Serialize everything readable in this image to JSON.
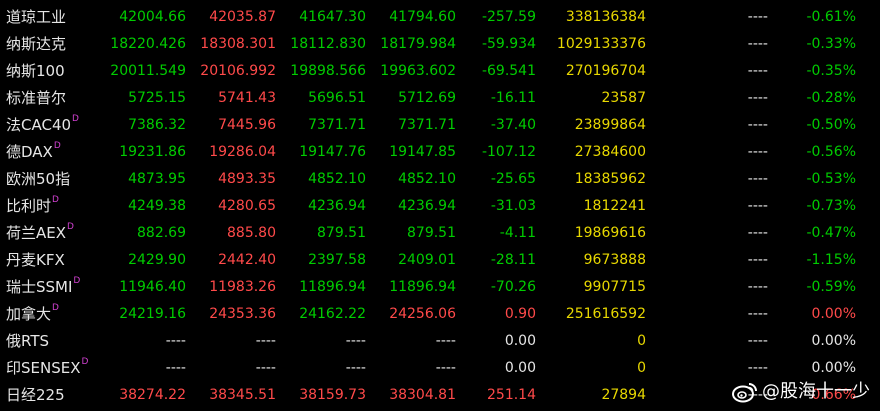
{
  "rows": [
    {
      "name": "道琼工业",
      "d": "",
      "v": [
        "42004.66",
        "42035.87",
        "41647.30",
        "41794.60",
        "-257.59",
        "338136384",
        "----",
        "-0.61%"
      ],
      "c": [
        "g",
        "r",
        "g",
        "g",
        "g",
        "y",
        "w",
        "g"
      ]
    },
    {
      "name": "纳斯达克",
      "d": "",
      "v": [
        "18220.426",
        "18308.301",
        "18112.830",
        "18179.984",
        "-59.934",
        "1029133376",
        "----",
        "-0.33%"
      ],
      "c": [
        "g",
        "r",
        "g",
        "g",
        "g",
        "y",
        "w",
        "g"
      ]
    },
    {
      "name": "纳斯100",
      "d": "",
      "v": [
        "20011.549",
        "20106.992",
        "19898.566",
        "19963.602",
        "-69.541",
        "270196704",
        "----",
        "-0.35%"
      ],
      "c": [
        "g",
        "r",
        "g",
        "g",
        "g",
        "y",
        "w",
        "g"
      ]
    },
    {
      "name": "标准普尔",
      "d": "",
      "v": [
        "5725.15",
        "5741.43",
        "5696.51",
        "5712.69",
        "-16.11",
        "23587",
        "----",
        "-0.28%"
      ],
      "c": [
        "g",
        "r",
        "g",
        "g",
        "g",
        "y",
        "w",
        "g"
      ]
    },
    {
      "name": "法CAC40",
      "d": "D",
      "v": [
        "7386.32",
        "7445.96",
        "7371.71",
        "7371.71",
        "-37.40",
        "23899864",
        "----",
        "-0.50%"
      ],
      "c": [
        "g",
        "r",
        "g",
        "g",
        "g",
        "y",
        "w",
        "g"
      ]
    },
    {
      "name": "德DAX",
      "d": "D",
      "v": [
        "19231.86",
        "19286.04",
        "19147.76",
        "19147.85",
        "-107.12",
        "27384600",
        "----",
        "-0.56%"
      ],
      "c": [
        "g",
        "r",
        "g",
        "g",
        "g",
        "y",
        "w",
        "g"
      ]
    },
    {
      "name": "欧洲50指",
      "d": "",
      "v": [
        "4873.95",
        "4893.35",
        "4852.10",
        "4852.10",
        "-25.65",
        "18385962",
        "----",
        "-0.53%"
      ],
      "c": [
        "g",
        "r",
        "g",
        "g",
        "g",
        "y",
        "w",
        "g"
      ]
    },
    {
      "name": "比利时",
      "d": "D",
      "v": [
        "4249.38",
        "4280.65",
        "4236.94",
        "4236.94",
        "-31.03",
        "1812241",
        "----",
        "-0.73%"
      ],
      "c": [
        "g",
        "r",
        "g",
        "g",
        "g",
        "y",
        "w",
        "g"
      ]
    },
    {
      "name": "荷兰AEX",
      "d": "D",
      "v": [
        "882.69",
        "885.80",
        "879.51",
        "879.51",
        "-4.11",
        "19869616",
        "----",
        "-0.47%"
      ],
      "c": [
        "g",
        "r",
        "g",
        "g",
        "g",
        "y",
        "w",
        "g"
      ]
    },
    {
      "name": "丹麦KFX",
      "d": "",
      "v": [
        "2429.90",
        "2442.40",
        "2397.58",
        "2409.01",
        "-28.11",
        "9673888",
        "----",
        "-1.15%"
      ],
      "c": [
        "g",
        "r",
        "g",
        "g",
        "g",
        "y",
        "w",
        "g"
      ]
    },
    {
      "name": "瑞士SSMI",
      "d": "D",
      "v": [
        "11946.40",
        "11983.26",
        "11896.94",
        "11896.94",
        "-70.26",
        "9907715",
        "----",
        "-0.59%"
      ],
      "c": [
        "g",
        "r",
        "g",
        "g",
        "g",
        "y",
        "w",
        "g"
      ]
    },
    {
      "name": "加拿大",
      "d": "D",
      "v": [
        "24219.16",
        "24353.36",
        "24162.22",
        "24256.06",
        "0.90",
        "251616592",
        "----",
        "0.00%"
      ],
      "c": [
        "g",
        "r",
        "g",
        "r",
        "r",
        "y",
        "w",
        "r"
      ]
    },
    {
      "name": "俄RTS",
      "d": "",
      "v": [
        "----",
        "----",
        "----",
        "----",
        "0.00",
        "0",
        "----",
        "0.00%"
      ],
      "c": [
        "w",
        "w",
        "w",
        "w",
        "w",
        "y",
        "w",
        "w"
      ]
    },
    {
      "name": "印SENSEX",
      "d": "D",
      "v": [
        "----",
        "----",
        "----",
        "----",
        "0.00",
        "0",
        "----",
        "0.00%"
      ],
      "c": [
        "w",
        "w",
        "w",
        "w",
        "w",
        "y",
        "w",
        "w"
      ]
    },
    {
      "name": "日经225",
      "d": "",
      "v": [
        "38274.22",
        "38345.51",
        "38159.73",
        "38304.81",
        "251.14",
        "27894",
        "----",
        "0.66%"
      ],
      "c": [
        "r",
        "r",
        "r",
        "r",
        "r",
        "y",
        "w",
        "r"
      ]
    }
  ],
  "watermark": {
    "text": "@股海十一少",
    "icon": "weibo-icon"
  }
}
